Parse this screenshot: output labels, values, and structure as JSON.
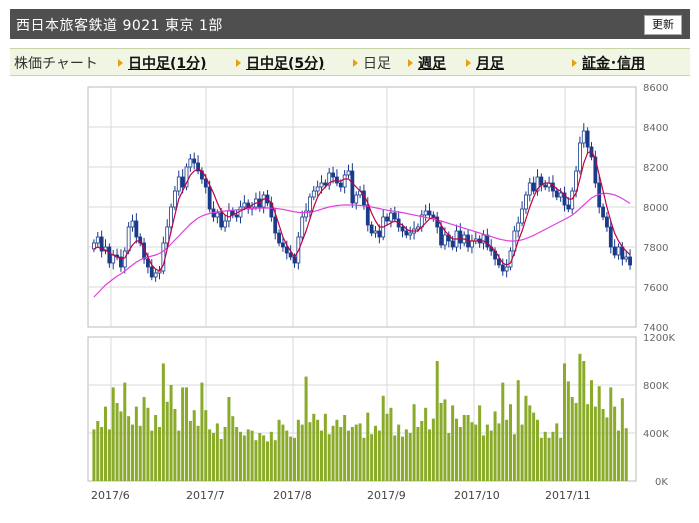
{
  "header": {
    "title": "西日本旅客鉄道  9021  東京 1部",
    "refresh_label": "更新"
  },
  "nav": {
    "chart_label": "株価チャート",
    "items": [
      {
        "label": "日中足(1分)",
        "link": true
      },
      {
        "label": "日中足(5分)",
        "link": true
      },
      {
        "label": "日足",
        "link": false
      },
      {
        "label": "週足",
        "link": true
      },
      {
        "label": "月足",
        "link": true
      },
      {
        "label": "証金･信用",
        "link": true
      }
    ]
  },
  "colors": {
    "up_candle": "#ffffff",
    "down_candle": "#1a3a8a",
    "ma_short": "#c00040",
    "ma_long": "#e040e0",
    "volume_bar": "#8aaa2a",
    "volume_profile": "#a0a0a0"
  },
  "chart_data": {
    "type": "candlestick",
    "price_axis": {
      "ticks": [
        "8600",
        "8400",
        "8200",
        "8000",
        "7800",
        "7600",
        "7400"
      ],
      "range": [
        7400,
        8600
      ]
    },
    "volume_axis": {
      "ticks": [
        "1200K",
        "800K",
        "400K",
        "0K"
      ],
      "range": [
        0,
        1200000
      ]
    },
    "x_tick_labels": [
      "2017/6",
      "2017/7",
      "2017/8",
      "2017/9",
      "2017/10",
      "2017/11"
    ],
    "closes": [
      7820,
      7850,
      7780,
      7800,
      7720,
      7760,
      7750,
      7700,
      7780,
      7900,
      7930,
      7850,
      7820,
      7740,
      7700,
      7650,
      7670,
      7680,
      7820,
      7900,
      8000,
      8080,
      8150,
      8100,
      8200,
      8240,
      8220,
      8180,
      8140,
      8100,
      7990,
      7950,
      7970,
      7900,
      7930,
      7980,
      7960,
      7950,
      8000,
      8020,
      7990,
      8000,
      8040,
      8000,
      8060,
      8020,
      7950,
      7870,
      7820,
      7800,
      7770,
      7750,
      7720,
      7850,
      7950,
      7980,
      8050,
      8080,
      8100,
      8120,
      8110,
      8170,
      8150,
      8120,
      8100,
      8160,
      8180,
      8020,
      8060,
      8080,
      8010,
      7910,
      7870,
      7880,
      7850,
      7950,
      7930,
      7970,
      7940,
      7900,
      7880,
      7860,
      7870,
      7890,
      7900,
      7960,
      7980,
      7960,
      7950,
      7900,
      7810,
      7860,
      7830,
      7800,
      7880,
      7820,
      7860,
      7800,
      7830,
      7840,
      7820,
      7860,
      7800,
      7780,
      7740,
      7710,
      7680,
      7700,
      7780,
      7880,
      7920,
      7990,
      8060,
      8120,
      8080,
      8150,
      8110,
      8100,
      8120,
      8080,
      8050,
      8070,
      8010,
      7990,
      8080,
      8180,
      8320,
      8380,
      8300,
      8250,
      8120,
      8000,
      7950,
      7900,
      7800,
      7760,
      7800,
      7740,
      7750,
      7710
    ],
    "ma_short": [
      7790,
      7800,
      7790,
      7785,
      7770,
      7760,
      7750,
      7740,
      7745,
      7780,
      7810,
      7830,
      7830,
      7790,
      7750,
      7710,
      7690,
      7680,
      7710,
      7790,
      7880,
      7960,
      8040,
      8080,
      8120,
      8160,
      8180,
      8190,
      8180,
      8150,
      8110,
      8070,
      8020,
      7980,
      7960,
      7950,
      7960,
      7970,
      7980,
      7990,
      8000,
      8010,
      8020,
      8020,
      8040,
      8040,
      8020,
      7970,
      7910,
      7850,
      7810,
      7780,
      7750,
      7780,
      7830,
      7880,
      7940,
      8000,
      8050,
      8080,
      8100,
      8120,
      8130,
      8130,
      8130,
      8140,
      8140,
      8120,
      8100,
      8080,
      8060,
      8020,
      7970,
      7930,
      7900,
      7900,
      7910,
      7920,
      7930,
      7920,
      7910,
      7890,
      7880,
      7880,
      7880,
      7900,
      7920,
      7940,
      7950,
      7940,
      7910,
      7880,
      7860,
      7840,
      7840,
      7840,
      7840,
      7830,
      7830,
      7830,
      7830,
      7830,
      7820,
      7800,
      7780,
      7750,
      7720,
      7710,
      7720,
      7770,
      7830,
      7880,
      7940,
      8000,
      8050,
      8090,
      8110,
      8120,
      8120,
      8110,
      8090,
      8080,
      8060,
      8040,
      8040,
      8070,
      8140,
      8220,
      8270,
      8280,
      8240,
      8160,
      8080,
      8000,
      7930,
      7870,
      7830,
      7800,
      7780,
      7760
    ],
    "ma_long": [
      7550,
      7570,
      7590,
      7610,
      7625,
      7640,
      7655,
      7665,
      7680,
      7695,
      7710,
      7725,
      7735,
      7745,
      7750,
      7755,
      7760,
      7768,
      7780,
      7795,
      7815,
      7835,
      7855,
      7875,
      7895,
      7915,
      7930,
      7945,
      7955,
      7962,
      7968,
      7972,
      7975,
      7978,
      7980,
      7982,
      7984,
      7986,
      7988,
      7990,
      7992,
      7993,
      7994,
      7994,
      7995,
      7995,
      7994,
      7993,
      7991,
      7988,
      7984,
      7980,
      7976,
      7973,
      7972,
      7972,
      7974,
      7978,
      7983,
      7989,
      7995,
      8000,
      8004,
      8007,
      8009,
      8010,
      8010,
      8010,
      8009,
      8008,
      8006,
      8004,
      8000,
      7996,
      7992,
      7988,
      7984,
      7981,
      7978,
      7975,
      7972,
      7968,
      7964,
      7960,
      7956,
      7952,
      7948,
      7944,
      7940,
      7936,
      7930,
      7924,
      7918,
      7912,
      7906,
      7900,
      7894,
      7888,
      7882,
      7876,
      7870,
      7864,
      7858,
      7852,
      7846,
      7840,
      7836,
      7832,
      7830,
      7830,
      7832,
      7836,
      7842,
      7850,
      7858,
      7868,
      7878,
      7888,
      7898,
      7908,
      7918,
      7928,
      7938,
      7948,
      7960,
      7975,
      7992,
      8010,
      8028,
      8045,
      8056,
      8064,
      8068,
      8068,
      8065,
      8060,
      8052,
      8042,
      8030,
      8018
    ],
    "volumes": [
      430,
      500,
      450,
      620,
      430,
      780,
      650,
      580,
      820,
      540,
      470,
      620,
      460,
      700,
      610,
      420,
      550,
      450,
      980,
      660,
      800,
      600,
      420,
      780,
      780,
      500,
      590,
      460,
      820,
      590,
      430,
      400,
      480,
      350,
      450,
      700,
      540,
      450,
      410,
      380,
      430,
      420,
      340,
      400,
      380,
      330,
      410,
      340,
      510,
      470,
      420,
      370,
      360,
      510,
      470,
      870,
      490,
      560,
      510,
      420,
      560,
      390,
      460,
      510,
      450,
      550,
      420,
      450,
      470,
      480,
      360,
      570,
      390,
      460,
      420,
      710,
      560,
      610,
      380,
      470,
      370,
      430,
      400,
      640,
      450,
      500,
      610,
      430,
      520,
      1000,
      650,
      680,
      400,
      630,
      520,
      450,
      550,
      550,
      490,
      470,
      630,
      380,
      470,
      420,
      580,
      480,
      820,
      510,
      640,
      390,
      840,
      470,
      710,
      630,
      570,
      510,
      360,
      410,
      360,
      410,
      480,
      360,
      980,
      830,
      700,
      650,
      1060,
      1000,
      640,
      840,
      620,
      790,
      600,
      530,
      780,
      620,
      420,
      690,
      440
    ]
  }
}
